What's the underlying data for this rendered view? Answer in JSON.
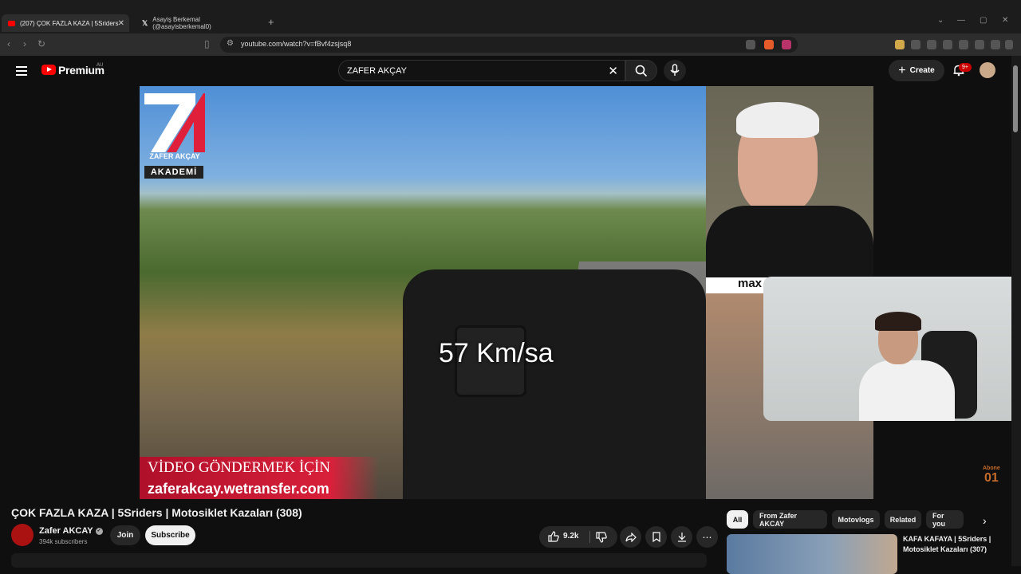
{
  "browser": {
    "tabs": [
      {
        "title": "(207) ÇOK FAZLA KAZA | 5Sriders",
        "active": true
      },
      {
        "title": "Asayiş Berkemal (@asayisberkemal0)",
        "active": false
      }
    ],
    "url": "youtube.com/watch?v=fBvf4zsjsq8"
  },
  "header": {
    "brand": "Premium",
    "region": "AU",
    "search_value": "ZAFER AKÇAY",
    "create_label": "Create",
    "notification_badge": "9+"
  },
  "video": {
    "logo_text": "ZAFER AKÇAY",
    "logo_sub": "AKADEMİ",
    "speed_text": "57 Km/sa",
    "banner_line1": "VİDEO GÖNDERMEK İÇİN",
    "banner_line2": "zaferakcay.wetransfer.com",
    "overlay_brand": "max",
    "abone_label": "Abone",
    "abone_value": "01"
  },
  "info": {
    "title": "ÇOK FAZLA KAZA | 5Sriders | Motosiklet Kazaları (308)",
    "channel": "Zafer AKCAY",
    "subscribers": "394k subscribers",
    "join_label": "Join",
    "subscribe_label": "Subscribe",
    "likes": "9.2k"
  },
  "chips": [
    "All",
    "From Zafer AKCAY",
    "Motovlogs",
    "Related",
    "For you"
  ],
  "recommendation": {
    "title_line1": "KAFA KAFAYA | 5Sriders |",
    "title_line2": "Motosiklet Kazaları (307)"
  },
  "colors": {
    "accent_red": "#ff0000",
    "background": "#0f0f0f",
    "banner_red": "#d8203a"
  }
}
